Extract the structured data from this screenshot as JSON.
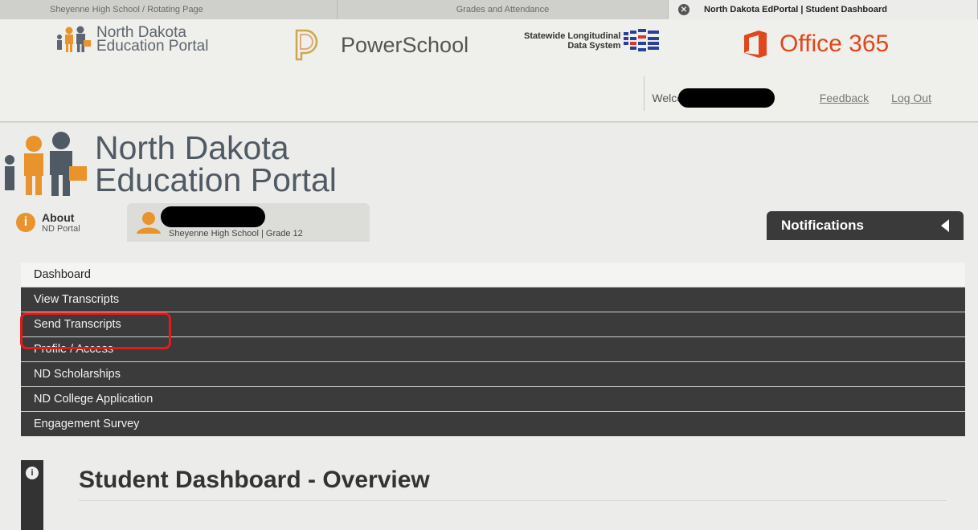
{
  "browser": {
    "tabs": [
      {
        "label": "Sheyenne High School / Rotating Page"
      },
      {
        "label": "Grades and Attendance"
      },
      {
        "label": "North Dakota EdPortal | Student Dashboard",
        "close": "✕"
      }
    ]
  },
  "portal_bar": {
    "nd_logo": {
      "line1": "North Dakota",
      "line2": "Education Portal"
    },
    "powerschool": "PowerSchool",
    "sl": {
      "line1": "Statewide Longitudinal",
      "line2": "Data System"
    },
    "office": "Office 365",
    "welcome": "Welcom",
    "feedback": "Feedback",
    "logout": "Log Out"
  },
  "header": {
    "brand_line1": "North Dakota",
    "brand_line2": "Education Portal",
    "about_title": "About",
    "about_sub": "ND Portal",
    "student_school": "Sheyenne High School | Grade 12",
    "notifications": "Notifications"
  },
  "menu": {
    "items": [
      {
        "label": "Dashboard",
        "active": true
      },
      {
        "label": "View Transcripts"
      },
      {
        "label": "Send Transcripts",
        "highlighted": true
      },
      {
        "label": "Profile / Access"
      },
      {
        "label": "ND Scholarships"
      },
      {
        "label": "ND College Application"
      },
      {
        "label": "Engagement Survey"
      }
    ]
  },
  "overview": {
    "title": "Student Dashboard - Overview"
  },
  "colors": {
    "accent_orange": "#e8932c",
    "menu_dark": "#3b3b3b",
    "office_red": "#e0471b",
    "highlight_red": "#e21b1b"
  }
}
